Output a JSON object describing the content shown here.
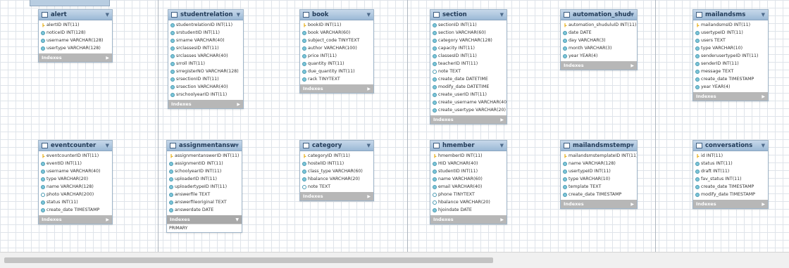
{
  "diagram": {
    "indexes_label": "Indexes",
    "tables": [
      {
        "name": "alert",
        "columns": [
          {
            "text": "alertID INT(11)",
            "icon": "key"
          },
          {
            "text": "noticeID INT(128)",
            "icon": "dot"
          },
          {
            "text": "username VARCHAR(128)",
            "icon": "dot"
          },
          {
            "text": "usertype VARCHAR(128)",
            "icon": "dot"
          }
        ]
      },
      {
        "name": "studentrelation",
        "columns": [
          {
            "text": "studentrelationID INT(11)",
            "icon": "dot"
          },
          {
            "text": "srstudentID INT(11)",
            "icon": "dot"
          },
          {
            "text": "srname VARCHAR(40)",
            "icon": "dot"
          },
          {
            "text": "srclassesID INT(11)",
            "icon": "dot"
          },
          {
            "text": "srclasses VARCHAR(40)",
            "icon": "dot"
          },
          {
            "text": "srroll INT(11)",
            "icon": "dot"
          },
          {
            "text": "srregisterNO VARCHAR(128)",
            "icon": "dot"
          },
          {
            "text": "srsectionID INT(11)",
            "icon": "dot"
          },
          {
            "text": "srsection VARCHAR(40)",
            "icon": "dot"
          },
          {
            "text": "srschoolyearID INT(11)",
            "icon": "dot"
          }
        ]
      },
      {
        "name": "book",
        "columns": [
          {
            "text": "bookID INT(11)",
            "icon": "key"
          },
          {
            "text": "book VARCHAR(60)",
            "icon": "dot"
          },
          {
            "text": "subject_code TINYTEXT",
            "icon": "dot"
          },
          {
            "text": "author VARCHAR(100)",
            "icon": "dot"
          },
          {
            "text": "price INT(11)",
            "icon": "dot"
          },
          {
            "text": "quantity INT(11)",
            "icon": "dot"
          },
          {
            "text": "due_quantity INT(11)",
            "icon": "dot"
          },
          {
            "text": "rack TINYTEXT",
            "icon": "dot"
          }
        ]
      },
      {
        "name": "section",
        "columns": [
          {
            "text": "sectionID INT(11)",
            "icon": "dot"
          },
          {
            "text": "section VARCHAR(60)",
            "icon": "dot"
          },
          {
            "text": "category VARCHAR(128)",
            "icon": "dot"
          },
          {
            "text": "capacity INT(11)",
            "icon": "dot"
          },
          {
            "text": "classesID INT(11)",
            "icon": "dot"
          },
          {
            "text": "teacherID INT(11)",
            "icon": "dot"
          },
          {
            "text": "note TEXT",
            "icon": "hollow"
          },
          {
            "text": "create_date DATETIME",
            "icon": "dot"
          },
          {
            "text": "modify_date DATETIME",
            "icon": "dot"
          },
          {
            "text": "create_userID INT(11)",
            "icon": "dot"
          },
          {
            "text": "create_username VARCHAR(40)",
            "icon": "dot"
          },
          {
            "text": "create_usertype VARCHAR(20)",
            "icon": "dot"
          }
        ]
      },
      {
        "name": "automation_shudulu",
        "columns": [
          {
            "text": "automation_shuduluID INT(11)",
            "icon": "key"
          },
          {
            "text": "date DATE",
            "icon": "dot"
          },
          {
            "text": "day VARCHAR(3)",
            "icon": "dot"
          },
          {
            "text": "month VARCHAR(3)",
            "icon": "dot"
          },
          {
            "text": "year YEAR(4)",
            "icon": "dot"
          }
        ]
      },
      {
        "name": "mailandsms",
        "columns": [
          {
            "text": "mailandsmsID INT(11)",
            "icon": "key"
          },
          {
            "text": "usertypeID INT(11)",
            "icon": "dot"
          },
          {
            "text": "users TEXT",
            "icon": "dot"
          },
          {
            "text": "type VARCHAR(10)",
            "icon": "dot"
          },
          {
            "text": "senderusertypeID INT(11)",
            "icon": "dot"
          },
          {
            "text": "senderID INT(11)",
            "icon": "dot"
          },
          {
            "text": "message TEXT",
            "icon": "dot"
          },
          {
            "text": "create_date TIMESTAMP",
            "icon": "dot"
          },
          {
            "text": "year YEAR(4)",
            "icon": "dot"
          }
        ]
      },
      {
        "name": "eventcounter",
        "columns": [
          {
            "text": "eventcounterID INT(11)",
            "icon": "key"
          },
          {
            "text": "eventID INT(11)",
            "icon": "dot"
          },
          {
            "text": "username VARCHAR(40)",
            "icon": "dot"
          },
          {
            "text": "type VARCHAR(20)",
            "icon": "dot"
          },
          {
            "text": "name VARCHAR(128)",
            "icon": "dot"
          },
          {
            "text": "photo VARCHAR(200)",
            "icon": "hollow"
          },
          {
            "text": "status INT(11)",
            "icon": "dot"
          },
          {
            "text": "create_date TIMESTAMP",
            "icon": "dot"
          }
        ]
      },
      {
        "name": "assignmentanswer",
        "index_item": "PRIMARY",
        "columns": [
          {
            "text": "assignmentanswerID INT(11)",
            "icon": "key"
          },
          {
            "text": "assignmentID INT(11)",
            "icon": "dot"
          },
          {
            "text": "schoolyearID INT(11)",
            "icon": "dot"
          },
          {
            "text": "uploaderID INT(11)",
            "icon": "dot"
          },
          {
            "text": "uploadertypeID INT(11)",
            "icon": "dot"
          },
          {
            "text": "answerfile TEXT",
            "icon": "dot"
          },
          {
            "text": "answerfileoriginal TEXT",
            "icon": "dot"
          },
          {
            "text": "answerdate DATE",
            "icon": "dot"
          }
        ]
      },
      {
        "name": "category",
        "columns": [
          {
            "text": "categoryID INT(11)",
            "icon": "key"
          },
          {
            "text": "hostelID INT(11)",
            "icon": "dot"
          },
          {
            "text": "class_type VARCHAR(60)",
            "icon": "dot"
          },
          {
            "text": "hbalance VARCHAR(20)",
            "icon": "dot"
          },
          {
            "text": "note TEXT",
            "icon": "hollow"
          }
        ]
      },
      {
        "name": "hmember",
        "columns": [
          {
            "text": "hmemberID INT(11)",
            "icon": "key"
          },
          {
            "text": "HID VARCHAR(40)",
            "icon": "dot"
          },
          {
            "text": "studentID INT(11)",
            "icon": "dot"
          },
          {
            "text": "name VARCHAR(60)",
            "icon": "dot"
          },
          {
            "text": "email VARCHAR(40)",
            "icon": "dot"
          },
          {
            "text": "phone TINYTEXT",
            "icon": "hollow"
          },
          {
            "text": "hbalance VARCHAR(20)",
            "icon": "hollow"
          },
          {
            "text": "hjoindate DATE",
            "icon": "dot"
          }
        ]
      },
      {
        "name": "mailandsmstemplate",
        "columns": [
          {
            "text": "mailandsmstemplateID INT(11)",
            "icon": "key"
          },
          {
            "text": "name VARCHAR(128)",
            "icon": "dot"
          },
          {
            "text": "usertypeID INT(11)",
            "icon": "dot"
          },
          {
            "text": "type VARCHAR(10)",
            "icon": "dot"
          },
          {
            "text": "template TEXT",
            "icon": "dot"
          },
          {
            "text": "create_date TIMESTAMP",
            "icon": "dot"
          }
        ]
      },
      {
        "name": "conversations",
        "columns": [
          {
            "text": "id INT(11)",
            "icon": "key"
          },
          {
            "text": "status INT(11)",
            "icon": "dot"
          },
          {
            "text": "draft INT(11)",
            "icon": "dot"
          },
          {
            "text": "fav_status INT(11)",
            "icon": "dot"
          },
          {
            "text": "create_date TIMESTAMP",
            "icon": "dot"
          },
          {
            "text": "modify_date TIMESTAMP",
            "icon": "dot"
          }
        ]
      }
    ]
  }
}
